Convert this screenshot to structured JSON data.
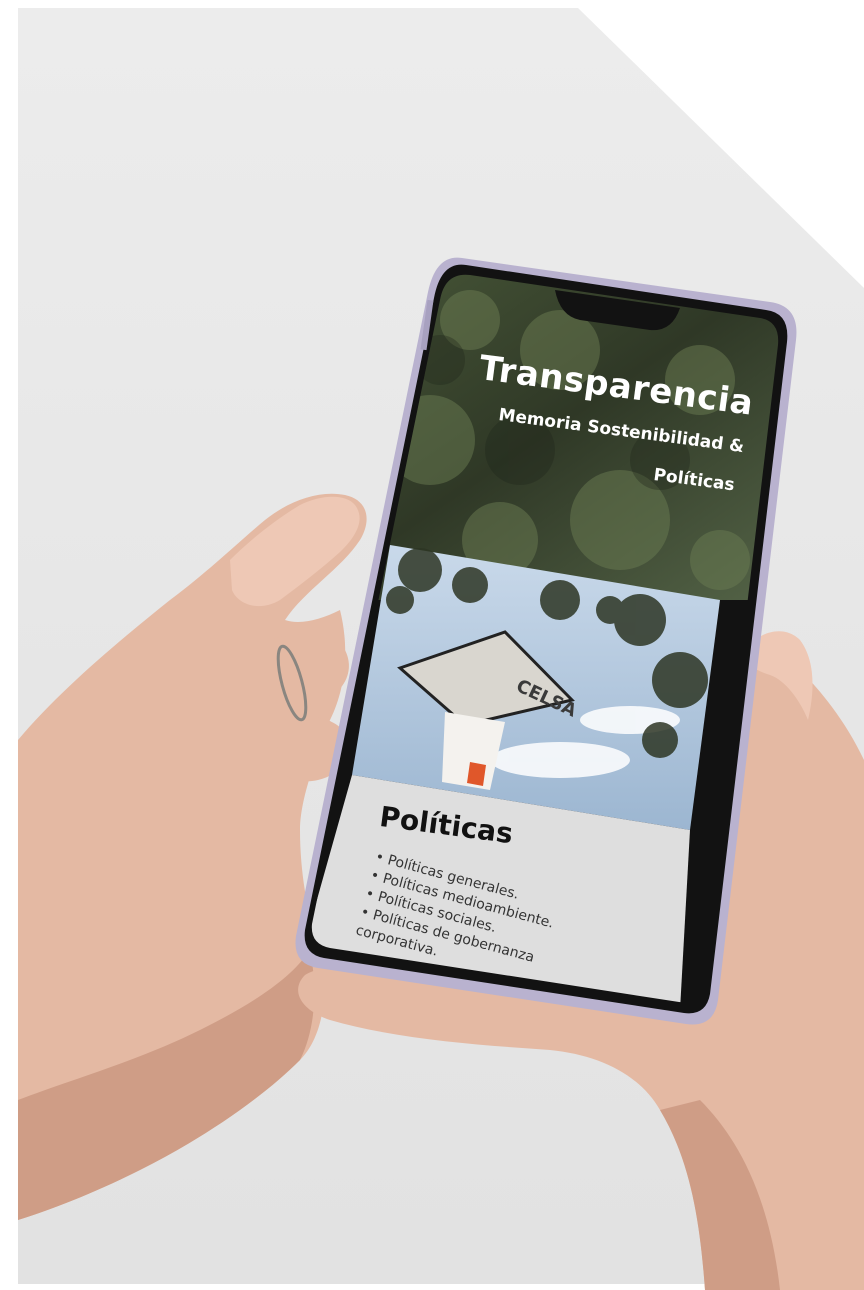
{
  "screen": {
    "title": "Transparencia",
    "subtitle_line1": "Memoria Sostenibilidad &",
    "subtitle_line2": "Políticas",
    "section_heading": "Políticas",
    "list_items": [
      "Políticas generales.",
      "Políticas medioambiente.",
      "Políticas sociales.",
      "Políticas de gobernanza"
    ],
    "list_continuation": "corporativa.",
    "photo_sign_text": "CELSA"
  },
  "colors": {
    "background": "#e8e8e8",
    "phone_frame": "#b9b2cf",
    "bezel": "#121212",
    "foliage": "#3f4a32",
    "card_bg": "#dedede",
    "heading": "#111111"
  }
}
